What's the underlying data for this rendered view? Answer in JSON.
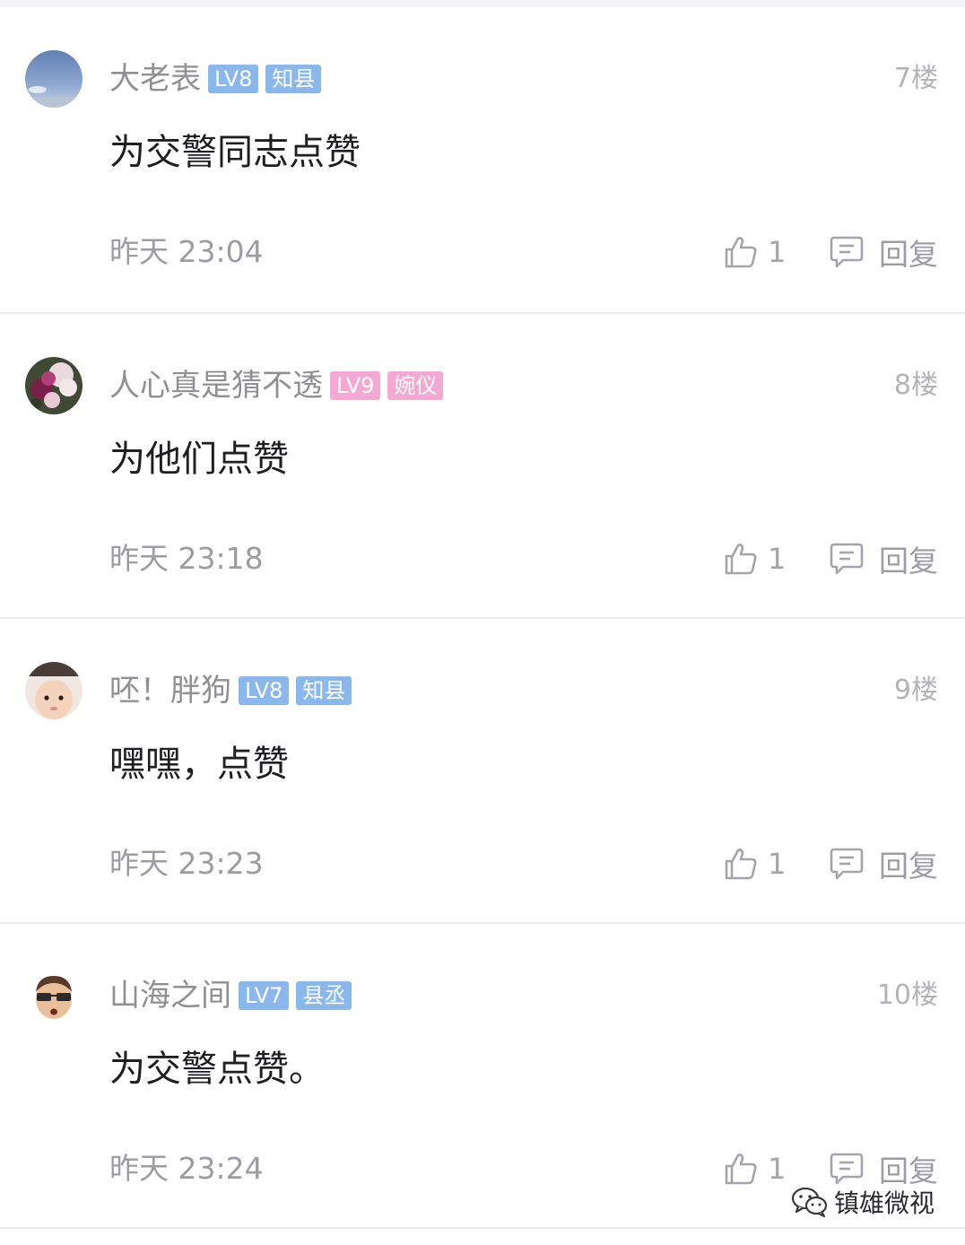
{
  "colors": {
    "badge_blue": "#8ab8ec",
    "badge_pink": "#f3a9d3",
    "text_primary": "#1f1f22",
    "text_secondary": "#9c9ca2"
  },
  "comments": [
    {
      "username": "大老表",
      "level": "LV8",
      "title": "知县",
      "badge_color": "blue",
      "floor": "7楼",
      "content": "为交警同志点赞",
      "time": "昨天 23:04",
      "likes": "1",
      "reply_label": "回复"
    },
    {
      "username": "人心真是猜不透",
      "level": "LV9",
      "title": "婉仪",
      "badge_color": "pink",
      "floor": "8楼",
      "content": "为他们点赞",
      "time": "昨天 23:18",
      "likes": "1",
      "reply_label": "回复"
    },
    {
      "username": "呸！胖狗",
      "level": "LV8",
      "title": "知县",
      "badge_color": "blue",
      "floor": "9楼",
      "content": "嘿嘿，点赞",
      "time": "昨天 23:23",
      "likes": "1",
      "reply_label": "回复"
    },
    {
      "username": "山海之间",
      "level": "LV7",
      "title": "县丞",
      "badge_color": "blue",
      "floor": "10楼",
      "content": "为交警点赞。",
      "time": "昨天 23:24",
      "likes": "1",
      "reply_label": "回复"
    }
  ],
  "watermark": {
    "icon": "wechat-icon",
    "text": "镇雄微视"
  }
}
